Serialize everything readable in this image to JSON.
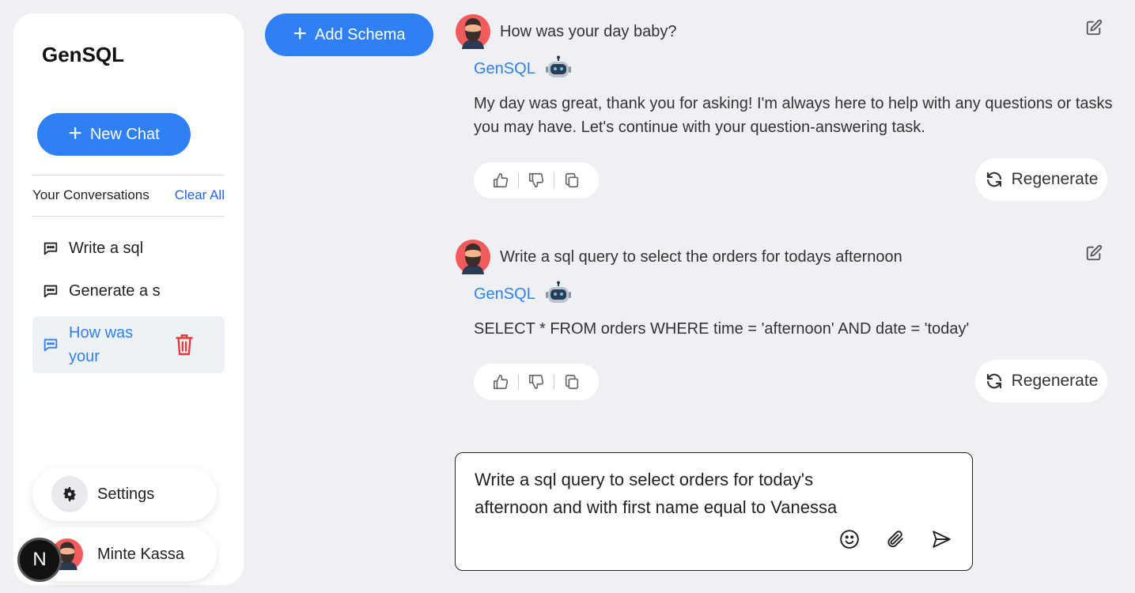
{
  "sidebar": {
    "brand": "GenSQL",
    "new_chat_label": "New Chat",
    "conversations_title": "Your Conversations",
    "clear_all_label": "Clear All",
    "items": [
      {
        "label": "Write a sql"
      },
      {
        "label": "Generate a s"
      },
      {
        "label": "How was your"
      }
    ],
    "settings_label": "Settings",
    "user_name": "Minte Kassa",
    "badge_letter": "N"
  },
  "toolbar": {
    "add_schema_label": "Add Schema"
  },
  "chat": {
    "messages": [
      {
        "user_text": "How was your day baby?",
        "bot_name": "GenSQL",
        "bot_text": "My day was great, thank you for asking! I'm always here to help with any questions or tasks you may have. Let's continue with your question-answering task.",
        "regenerate_label": "Regenerate"
      },
      {
        "user_text": "Write a sql query to select the orders for todays afternoon",
        "bot_name": "GenSQL",
        "bot_text": "SELECT * FROM orders WHERE time = 'afternoon' AND date = 'today'",
        "regenerate_label": "Regenerate"
      }
    ]
  },
  "composer": {
    "value": "Write a sql query to select orders for today's\nafternoon and with first name equal to Vanessa"
  },
  "colors": {
    "accent": "#2f80f4",
    "danger": "#e53935",
    "background": "#eef0f3"
  }
}
